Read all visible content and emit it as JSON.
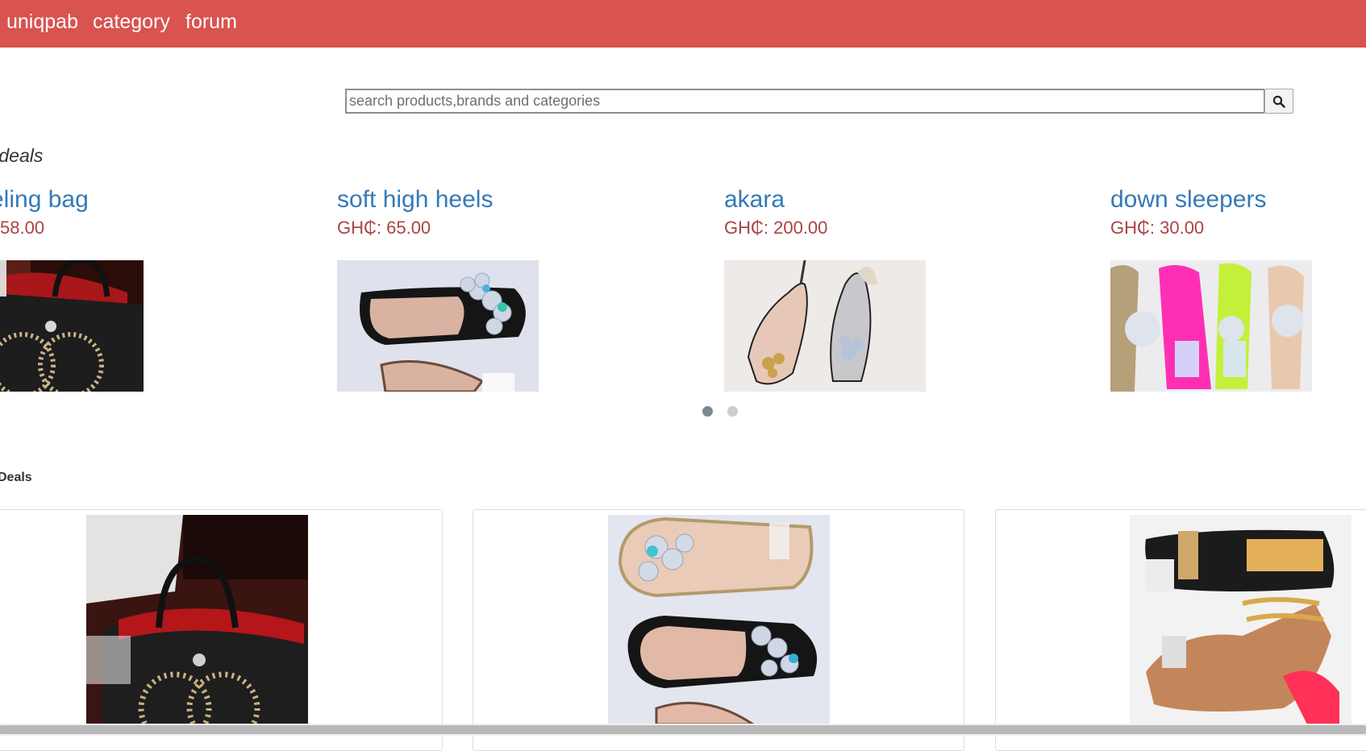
{
  "nav": {
    "brand": "uniqpab",
    "links": [
      "category",
      "forum"
    ]
  },
  "search": {
    "placeholder": "search products,brands and categories",
    "button_icon": "search-icon"
  },
  "featured": {
    "title": "deals",
    "items": [
      {
        "name": "eling bag",
        "price": "58.00"
      },
      {
        "name": "soft high heels",
        "price": "GH₵: 65.00"
      },
      {
        "name": "akara",
        "price": "GH₵: 200.00"
      },
      {
        "name": "down sleepers",
        "price": "GH₵: 30.00"
      }
    ],
    "indicators": {
      "count": 2,
      "active": 1
    }
  },
  "deals": {
    "heading": "Deals",
    "cards": [
      "bag photo",
      "heels photo",
      "sandals photo"
    ]
  },
  "colors": {
    "navbar": "#d9534f",
    "link": "#337ab7",
    "price": "#a94442"
  }
}
